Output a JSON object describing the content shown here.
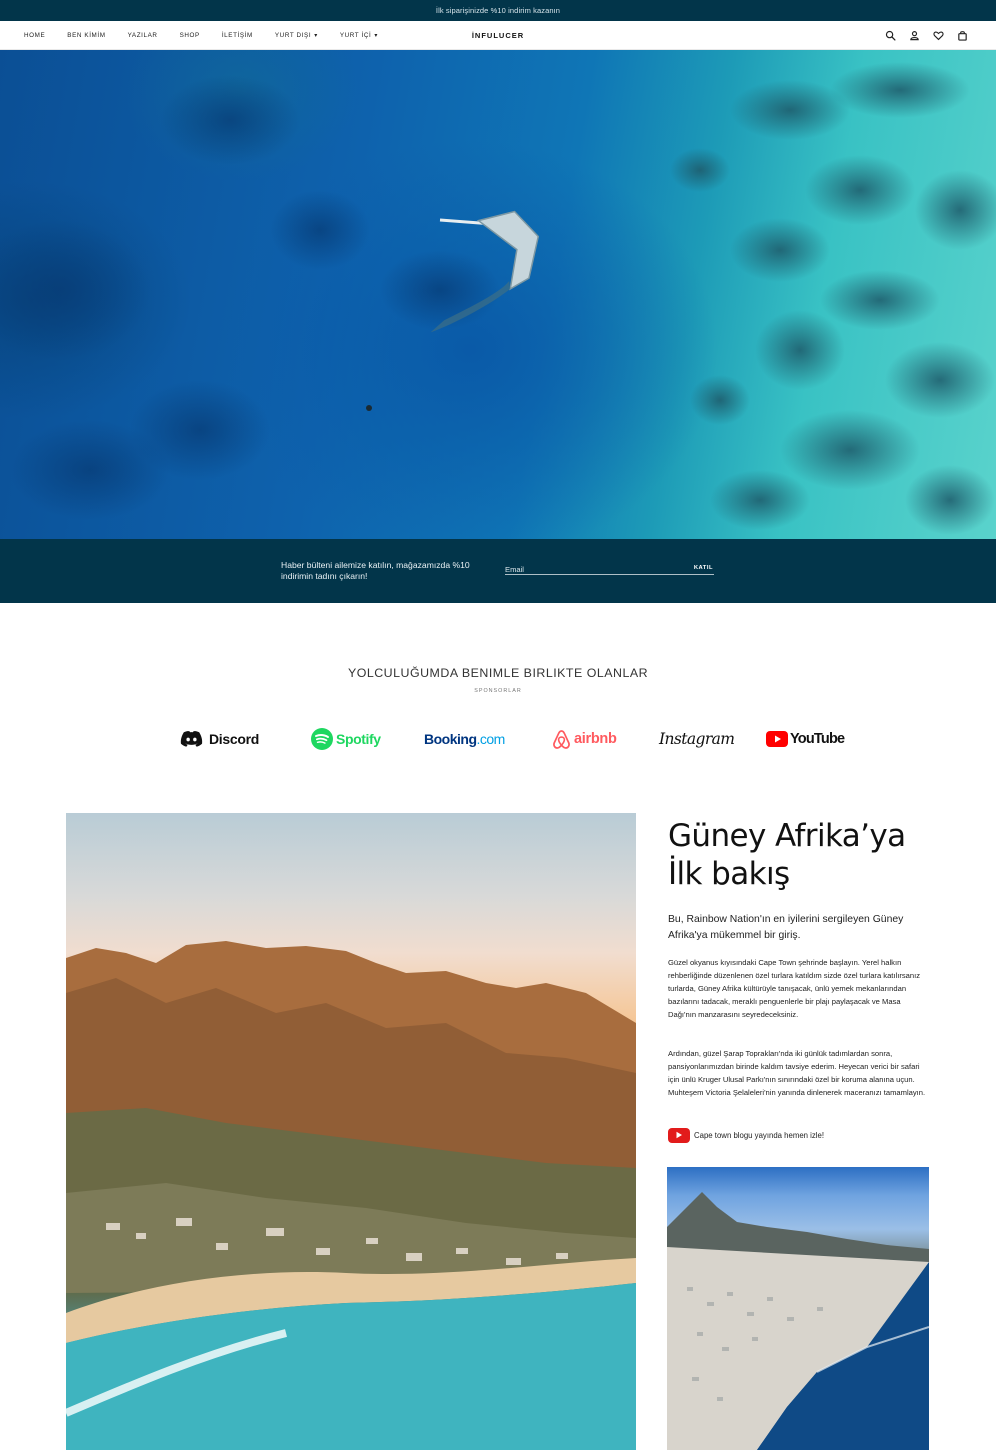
{
  "announcement": "İlk siparişinizde %10 indirim kazanın",
  "nav": {
    "links": [
      "HOME",
      "BEN KİMİM",
      "YAZILAR",
      "SHOP",
      "İLETİŞİM",
      "YURT DIŞI",
      "YURT İÇİ"
    ],
    "brand": "İNFULUCER",
    "icons": [
      "search-icon",
      "user-icon",
      "heart-icon",
      "bag-icon"
    ]
  },
  "newsletter": {
    "text": "Haber bülteni ailemize katılın, mağazamızda %10 indirimin tadını çıkarın!",
    "email_placeholder": "Email",
    "button": "KATIL"
  },
  "sponsors": {
    "title": "YOLCULUĞUMDA BENIMLE BIRLIKTE OLANLAR",
    "subtitle": "SPONSORLAR",
    "logos": [
      "Discord",
      "Spotify",
      "Booking",
      ".com",
      "airbnb",
      "Instagram",
      "YouTube"
    ]
  },
  "article": {
    "title_line1": "Güney Afrika’ya",
    "title_line2": "İlk bakış",
    "lead": "Bu, Rainbow Nation'ın en iyilerini sergileyen Güney Afrika'ya mükemmel bir giriş.",
    "paragraph1": "Güzel okyanus kıyısındaki Cape Town şehrinde başlayın. Yerel halkın rehberliğinde düzenlenen özel turlara katıldım sizde özel turlara katılırsanız turlarda, Güney Afrika kültürüyle tanışacak, ünlü yemek mekanlarından bazılarını tadacak, meraklı penguenlerle bir plajı paylaşacak ve Masa Dağı'nın manzarasını seyredeceksiniz.",
    "paragraph2": "Ardından, güzel Şarap Toprakları'nda iki günlük tadımlardan sonra,   pansiyonlarımızdan birinde kaldım tavsiye ederim. Heyecan verici bir safari için ünlü Kruger Ulusal Parkı'nın sınırındaki özel bir koruma alanına uçun. Muhteşem Victoria Şelaleleri'nin yanında dinlenerek maceranızı tamamlayın.",
    "youtube_link": "Cape town blogu yayında hemen izle!"
  },
  "colors": {
    "navy": "#02354a",
    "youtube_red": "#e21b1b",
    "spotify_green": "#1ed760",
    "airbnb_red": "#ff5a5f",
    "booking_blue": "#003580",
    "booking_light": "#009fe3"
  }
}
